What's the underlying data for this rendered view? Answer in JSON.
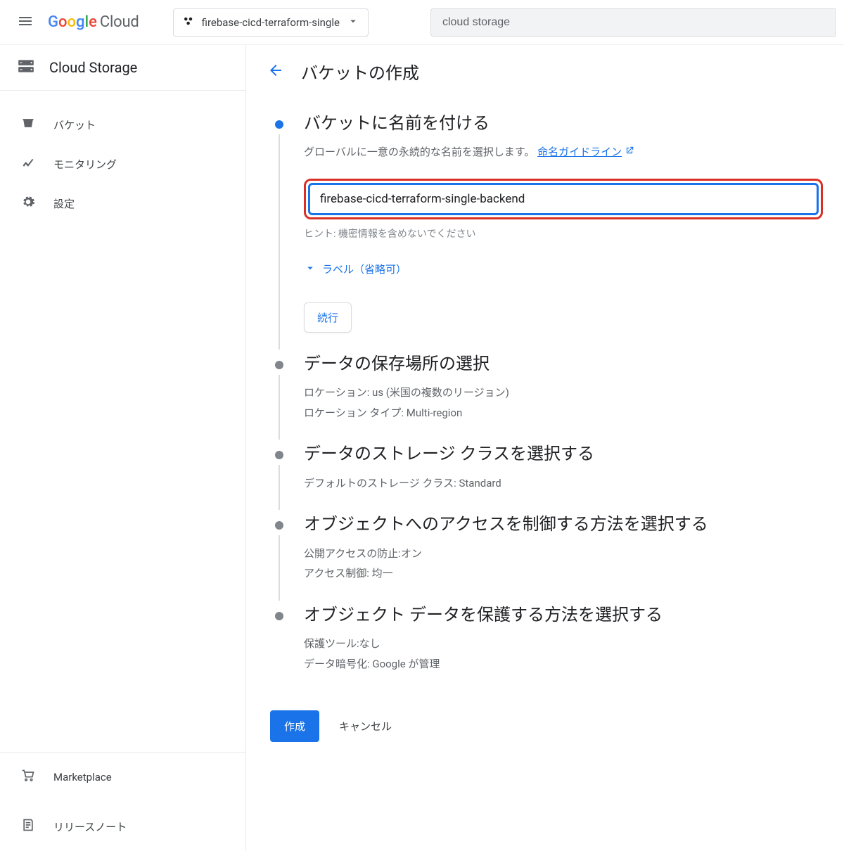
{
  "header": {
    "logo_google": [
      {
        "ch": "G",
        "color": "#4285F4"
      },
      {
        "ch": "o",
        "color": "#EA4335"
      },
      {
        "ch": "o",
        "color": "#FBBC05"
      },
      {
        "ch": "g",
        "color": "#4285F4"
      },
      {
        "ch": "l",
        "color": "#34A853"
      },
      {
        "ch": "e",
        "color": "#EA4335"
      }
    ],
    "logo_cloud": "Cloud",
    "project_name": "firebase-cicd-terraform-single",
    "search_value": "cloud storage"
  },
  "sidebar": {
    "title": "Cloud Storage",
    "items": [
      {
        "icon": "bucket",
        "label": "バケット"
      },
      {
        "icon": "chart",
        "label": "モニタリング"
      },
      {
        "icon": "gear",
        "label": "設定"
      }
    ],
    "bottom_items": [
      {
        "icon": "cart",
        "label": "Marketplace"
      },
      {
        "icon": "notes",
        "label": "リリースノート"
      }
    ]
  },
  "main": {
    "page_title": "バケットの作成",
    "steps": [
      {
        "title": "バケットに名前を付ける",
        "desc_prefix": "グローバルに一意の永続的な名前を選択します。",
        "link_text": "命名ガイドライン",
        "input_value": "firebase-cicd-terraform-single-backend",
        "hint": "ヒント: 機密情報を含めないでください",
        "labels_toggle": "ラベル（省略可）",
        "continue_label": "続行"
      },
      {
        "title": "データの保存場所の選択",
        "lines": [
          "ロケーション: us (米国の複数のリージョン)",
          "ロケーション タイプ: Multi-region"
        ]
      },
      {
        "title": "データのストレージ クラスを選択する",
        "lines": [
          "デフォルトのストレージ クラス: Standard"
        ]
      },
      {
        "title": "オブジェクトへのアクセスを制御する方法を選択する",
        "lines": [
          "公開アクセスの防止:オン",
          "アクセス制御: 均一"
        ]
      },
      {
        "title": "オブジェクト データを保護する方法を選択する",
        "lines": [
          "保護ツール:なし",
          "データ暗号化: Google が管理"
        ]
      }
    ],
    "footer": {
      "create": "作成",
      "cancel": "キャンセル"
    }
  }
}
